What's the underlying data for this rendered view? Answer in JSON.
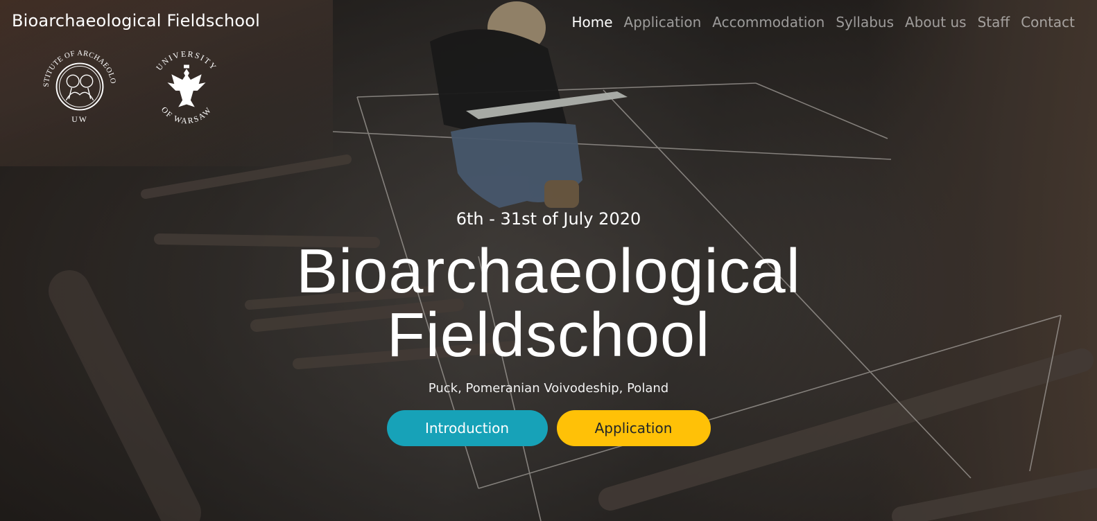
{
  "navbar": {
    "brand": "Bioarchaeological Fieldschool",
    "items": [
      {
        "label": "Home",
        "active": true
      },
      {
        "label": "Application",
        "active": false
      },
      {
        "label": "Accommodation",
        "active": false
      },
      {
        "label": "Syllabus",
        "active": false
      },
      {
        "label": "About us",
        "active": false
      },
      {
        "label": "Staff",
        "active": false
      },
      {
        "label": "Contact",
        "active": false
      }
    ]
  },
  "logos": {
    "institute": {
      "text_top": "INSTITUTE OF ARCHAEOLOGY",
      "text_bottom": "UW"
    },
    "university": {
      "text_top": "UNIVERSITY",
      "text_bottom": "OF WARSAW"
    }
  },
  "hero": {
    "date": "6th - 31st of July 2020",
    "title_line1": "Bioarchaeological",
    "title_line2": "Fieldschool",
    "location": "Puck, Pomeranian Voivodeship, Poland",
    "buttons": {
      "introduction": "Introduction",
      "application": "Application"
    }
  },
  "colors": {
    "intro_button": "#17a2b8",
    "application_button": "#ffc107",
    "nav_active": "#ffffff",
    "nav_inactive": "rgba(255,255,255,0.55)"
  }
}
